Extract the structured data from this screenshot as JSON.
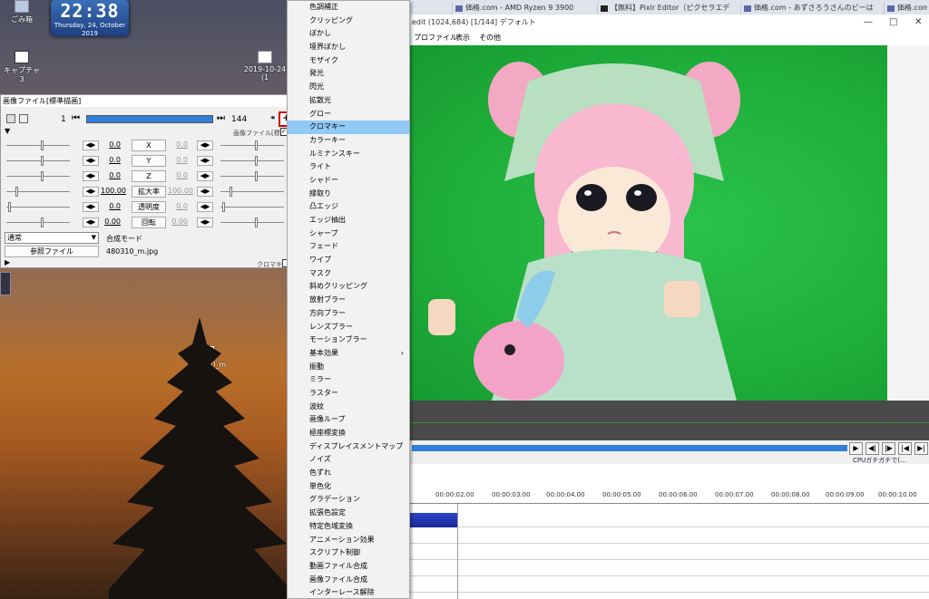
{
  "desktop": {
    "recycle_label": "ごみ箱",
    "clock_time": "22:38",
    "clock_date": "Thursday, 24, October",
    "clock_year": "2019",
    "capture_label": "キャプチャ3",
    "dated_folder": "2019-10-24 (1",
    "file_icon_label": "480310_m"
  },
  "browser": {
    "tabs": [
      {
        "label": "価格.com - AMD Ryzen 9 3900"
      },
      {
        "label": "【無料】Pixlr Editor（ピクセラエディ"
      },
      {
        "label": "価格.com - あずさろうさんのビーは"
      },
      {
        "label": "価格.com"
      }
    ],
    "window_title_suffix": "edit (1024,684)  [1/144]  デフォルト",
    "menu_items": [
      "プロファイル",
      "表示",
      "その他"
    ],
    "timeline_times": [
      "00:00:02.00",
      "00:00:03.00",
      "00:00:04.00",
      "00:00:05.00",
      "00:00:06.00",
      "00:00:07.00",
      "00:00:08.00",
      "00:00:09.00",
      "00:00:10.00"
    ],
    "cpu_link_text": "CPUガチガチで(…",
    "playback_icons": [
      "play-icon",
      "step-back-icon",
      "step-forward-icon",
      "go-start-icon",
      "go-end-icon"
    ]
  },
  "panel": {
    "title": "画像ファイル[標準描画]",
    "frame_start": "1",
    "frame_end": "144",
    "filter_caption": "画像ファイル[標準描画]",
    "params": [
      {
        "value": "0.0",
        "label": "X",
        "value2": "0.0"
      },
      {
        "value": "0.0",
        "label": "Y",
        "value2": "0.0"
      },
      {
        "value": "0.0",
        "label": "Z",
        "value2": "0.0"
      },
      {
        "value": "100.00",
        "label": "拡大率",
        "value2": "100.00"
      },
      {
        "value": "0.0",
        "label": "透明度",
        "value2": "0.0"
      },
      {
        "value": "0.00",
        "label": "回転",
        "value2": "0.00"
      }
    ],
    "blend_value": "通常",
    "blend_label": "合成モード",
    "ref_button": "参照ファイル",
    "file_name": "480310_m.jpg",
    "chroma_caption": "クロマキー"
  },
  "context_menu": {
    "items": [
      "色調補正",
      "クリッピング",
      "ぼかし",
      "境界ぼかし",
      "モザイク",
      "発光",
      "閃光",
      "拡散光",
      "グロー",
      "クロマキー",
      "カラーキー",
      "ルミナンスキー",
      "ライト",
      "シャドー",
      "縁取り",
      "凸エッジ",
      "エッジ抽出",
      "シャープ",
      "フェード",
      "ワイプ",
      "マスク",
      "斜めクリッピング",
      "放射ブラー",
      "方向ブラー",
      "レンズブラー",
      "モーションブラー",
      "基本効果",
      "振動",
      "ミラー",
      "ラスター",
      "波紋",
      "画像ループ",
      "極座標変換",
      "ディスプレイスメントマップ",
      "ノイズ",
      "色ずれ",
      "単色化",
      "グラデーション",
      "拡張色設定",
      "特定色域変換",
      "アニメーション効果",
      "スクリプト制御",
      "動画ファイル合成",
      "画像ファイル合成",
      "インターレース解除"
    ],
    "selected": "クロマキー",
    "submenu_item": "基本効果"
  },
  "colors": {
    "highlight": "#91c9f7",
    "seek": "#2f7fd8",
    "chroma_green": "#1fae3a",
    "red_outline": "#d40000"
  }
}
